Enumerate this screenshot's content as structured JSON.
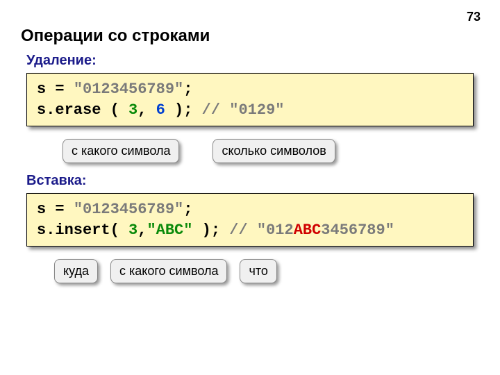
{
  "page_number": "73",
  "title": "Операции со строками",
  "section1": {
    "label": "Удаление:",
    "code": {
      "assign_left": "s = ",
      "assign_str": "\"0123456789\"",
      "assign_end": ";",
      "call_left": "s.erase ( ",
      "arg1": "3",
      "comma": ", ",
      "arg2": "6",
      "call_right": " ); ",
      "comment_prefix": "// ",
      "comment_str": "\"0129\""
    },
    "callouts": [
      "с какого\nсимвола",
      "сколько\nсимволов"
    ]
  },
  "section2": {
    "label": "Вставка:",
    "code": {
      "assign_left": "s = ",
      "assign_str": "\"0123456789\"",
      "assign_end": ";",
      "call_left": "s.insert( ",
      "arg1": "3",
      "comma": ",",
      "arg2": "\"ABC\"",
      "call_right": " ); ",
      "comment_prefix": "// \"012",
      "comment_mid": "ABC",
      "comment_suffix": "3456789\""
    },
    "callouts": [
      "куда",
      "с какого\nсимвола",
      "что"
    ]
  }
}
